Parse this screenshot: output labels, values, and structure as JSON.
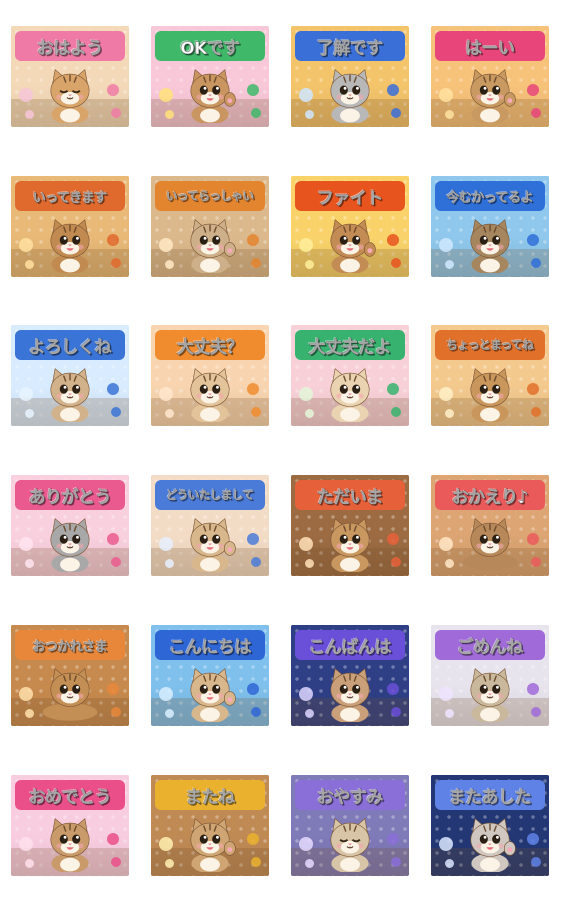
{
  "stickers": [
    {
      "text": "おはよう",
      "bg": "#f3d9b8",
      "accent": "#f07aa6",
      "banner": "#f6c6d8",
      "fur": "#d9a46a",
      "pose": "sleepy"
    },
    {
      "text": "OKです",
      "bg": "#f8c8d8",
      "accent": "#3fb86a",
      "banner": "#ffe27a",
      "fur": "#c99560",
      "pose": "wave"
    },
    {
      "text": "了解です",
      "bg": "#f4c46b",
      "accent": "#3a6fd8",
      "banner": "#cfe6ff",
      "fur": "#b8b8b8",
      "pose": "sit"
    },
    {
      "text": "はーい",
      "bg": "#f7c27a",
      "accent": "#e8457a",
      "banner": "#ffe2a0",
      "fur": "#c89a62",
      "pose": "wave"
    },
    {
      "text": "いってきます",
      "bg": "#e8b977",
      "accent": "#e06a2e",
      "banner": "#ffe0a0",
      "fur": "#c08a50",
      "pose": "happy"
    },
    {
      "text": "いってらっしゃい",
      "bg": "#dcb98c",
      "accent": "#e3842f",
      "banner": "#ffe9c4",
      "fur": "#cdb089",
      "pose": "wave"
    },
    {
      "text": "ファイト",
      "bg": "#f9d36a",
      "accent": "#e8541e",
      "banner": "#ffef9a",
      "fur": "#c48c55",
      "pose": "wave"
    },
    {
      "text": "今むかってるよ",
      "bg": "#8fc8ec",
      "accent": "#2f6fd8",
      "banner": "#cfe9ff",
      "fur": "#a6865e",
      "pose": "walk"
    },
    {
      "text": "よろしくね",
      "bg": "#d9ecff",
      "accent": "#3a74d6",
      "banner": "#e8f3ff",
      "fur": "#d1b28a",
      "pose": "sit"
    },
    {
      "text": "大丈夫？",
      "bg": "#f8d5b0",
      "accent": "#f08c2e",
      "banner": "#ffe6cc",
      "fur": "#e2c39a",
      "pose": "sit"
    },
    {
      "text": "大丈夫だよ",
      "bg": "#f8d1d8",
      "accent": "#37b36f",
      "banner": "#e3f6d8",
      "fur": "#ead3b0",
      "pose": "sit"
    },
    {
      "text": "ちょっとまってね",
      "bg": "#f3c98e",
      "accent": "#e0702a",
      "banner": "#fff0c8",
      "fur": "#c9965c",
      "pose": "sit"
    },
    {
      "text": "ありがとう",
      "bg": "#f9d0de",
      "accent": "#ea5a8e",
      "banner": "#ffe4ef",
      "fur": "#a8a8a8",
      "pose": "sit"
    },
    {
      "text": "どういたしまして",
      "bg": "#f3dcc6",
      "accent": "#4a7bd8",
      "banner": "#e6f0ff",
      "fur": "#d8b78c",
      "pose": "wave"
    },
    {
      "text": "ただいま",
      "bg": "#9c6b42",
      "accent": "#e6603a",
      "banner": "#ffe0b8",
      "fur": "#c99760",
      "pose": "happy"
    },
    {
      "text": "おかえり♪",
      "bg": "#dca573",
      "accent": "#ea5a5a",
      "banner": "#ffe6c6",
      "fur": "#b7895a",
      "pose": "lie"
    },
    {
      "text": "おつかれさま",
      "bg": "#c78a4e",
      "accent": "#e8873a",
      "banner": "#ffe1aa",
      "fur": "#c48f55",
      "pose": "lie"
    },
    {
      "text": "こんにちは",
      "bg": "#7fc0ec",
      "accent": "#2f66d6",
      "banner": "#d8eeff",
      "fur": "#d8b78c",
      "pose": "wave"
    },
    {
      "text": "こんばんは",
      "bg": "#2f3f86",
      "accent": "#6a4fd8",
      "banner": "#dcd6ff",
      "fur": "#c9a07a",
      "pose": "sit"
    },
    {
      "text": "ごめんね",
      "bg": "#e8e4ee",
      "accent": "#a06ad8",
      "banner": "#efe4ff",
      "fur": "#c9b89c",
      "pose": "sit"
    },
    {
      "text": "おめでとう",
      "bg": "#f8cde0",
      "accent": "#ea4f8a",
      "banner": "#ffe0ec",
      "fur": "#c99a6a",
      "pose": "happy"
    },
    {
      "text": "またね",
      "bg": "#c08a55",
      "accent": "#eab12e",
      "banner": "#fff0b0",
      "fur": "#cfa673",
      "pose": "wave"
    },
    {
      "text": "おやすみ",
      "bg": "#7f7ab8",
      "accent": "#8a6fd8",
      "banner": "#e6dcff",
      "fur": "#d8c4a6",
      "pose": "sleepy"
    },
    {
      "text": "またあした",
      "bg": "#233775",
      "accent": "#5f82e6",
      "banner": "#dbe6ff",
      "fur": "#cfc7c0",
      "pose": "wave"
    }
  ]
}
